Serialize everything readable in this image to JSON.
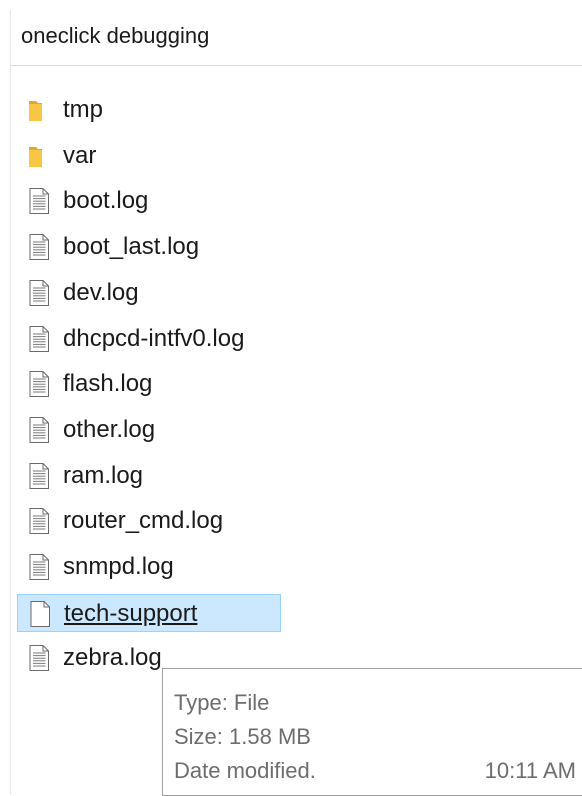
{
  "window": {
    "title": "oneclick debugging"
  },
  "files": [
    {
      "name": "tmp",
      "icon": "folder-icon",
      "type": "folder"
    },
    {
      "name": "var",
      "icon": "folder-icon",
      "type": "folder"
    },
    {
      "name": "boot.log",
      "icon": "text-file-icon",
      "type": "file"
    },
    {
      "name": "boot_last.log",
      "icon": "text-file-icon",
      "type": "file"
    },
    {
      "name": "dev.log",
      "icon": "text-file-icon",
      "type": "file"
    },
    {
      "name": "dhcpcd-intfv0.log",
      "icon": "text-file-icon",
      "type": "file"
    },
    {
      "name": "flash.log",
      "icon": "text-file-icon",
      "type": "file"
    },
    {
      "name": "other.log",
      "icon": "text-file-icon",
      "type": "file"
    },
    {
      "name": "ram.log",
      "icon": "text-file-icon",
      "type": "file"
    },
    {
      "name": "router_cmd.log",
      "icon": "text-file-icon",
      "type": "file"
    },
    {
      "name": "snmpd.log",
      "icon": "text-file-icon",
      "type": "file"
    },
    {
      "name": "tech-support",
      "icon": "blank-file-icon",
      "type": "file",
      "selected": true
    },
    {
      "name": "zebra.log",
      "icon": "text-file-icon",
      "type": "file"
    }
  ],
  "tooltip": {
    "type_line": "Type: File",
    "size_line": "Size: 1.58 MB",
    "date_label": "Date modified.",
    "date_value": "10:11 AM"
  },
  "colors": {
    "selection_bg": "#cce8ff",
    "selection_border": "#99d1ff",
    "folder": "#f8c545",
    "folder_dark": "#e0a82e"
  }
}
